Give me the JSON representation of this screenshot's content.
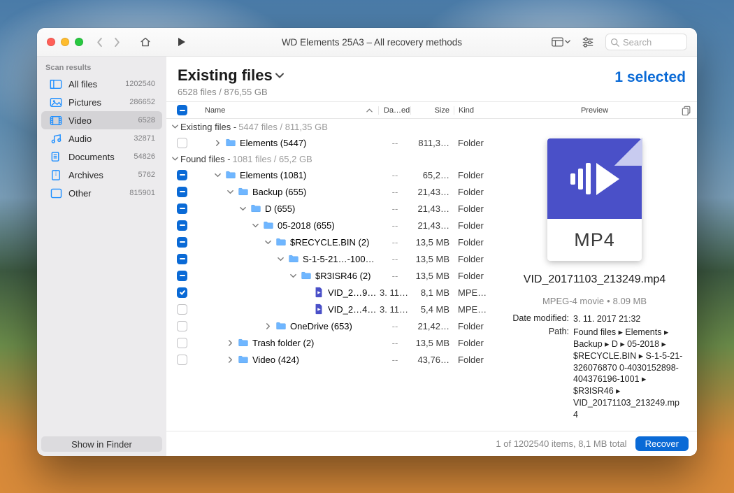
{
  "window_title": "WD Elements 25A3 – All recovery methods",
  "search_placeholder": "Search",
  "sidebar": {
    "heading": "Scan results",
    "items": [
      {
        "label": "All files",
        "count": "1202540",
        "icon": "allfiles"
      },
      {
        "label": "Pictures",
        "count": "286652",
        "icon": "pictures"
      },
      {
        "label": "Video",
        "count": "6528",
        "icon": "video",
        "selected": true
      },
      {
        "label": "Audio",
        "count": "32871",
        "icon": "audio"
      },
      {
        "label": "Documents",
        "count": "54826",
        "icon": "documents"
      },
      {
        "label": "Archives",
        "count": "5762",
        "icon": "archives"
      },
      {
        "label": "Other",
        "count": "815901",
        "icon": "other"
      }
    ],
    "finder_btn": "Show in Finder"
  },
  "header": {
    "title": "Existing files",
    "subtitle": "6528 files / 876,55 GB",
    "selected": "1 selected"
  },
  "columns": {
    "name": "Name",
    "date": "Da…ed",
    "size": "Size",
    "kind": "Kind"
  },
  "sections": {
    "existing": {
      "label": "Existing files",
      "meta": "5447 files / 811,35 GB"
    },
    "found": {
      "label": "Found files",
      "meta": "1081 files / 65,2 GB"
    }
  },
  "rows": [
    {
      "indent": 1,
      "chev": "right",
      "check": "none",
      "icon": "folder",
      "name": "Elements (5447)",
      "date": "--",
      "size": "811,3…",
      "kind": "Folder"
    },
    {
      "section": "found"
    },
    {
      "indent": 1,
      "chev": "down",
      "check": "some",
      "icon": "folder",
      "name": "Elements (1081)",
      "date": "--",
      "size": "65,2…",
      "kind": "Folder"
    },
    {
      "indent": 2,
      "chev": "down",
      "check": "some",
      "icon": "folder",
      "name": "Backup (655)",
      "date": "--",
      "size": "21,43…",
      "kind": "Folder"
    },
    {
      "indent": 3,
      "chev": "down",
      "check": "some",
      "icon": "folder",
      "name": "D (655)",
      "date": "--",
      "size": "21,43…",
      "kind": "Folder"
    },
    {
      "indent": 4,
      "chev": "down",
      "check": "some",
      "icon": "folder",
      "name": "05-2018 (655)",
      "date": "--",
      "size": "21,43…",
      "kind": "Folder"
    },
    {
      "indent": 5,
      "chev": "down",
      "check": "some",
      "icon": "folder",
      "name": "$RECYCLE.BIN (2)",
      "date": "--",
      "size": "13,5 MB",
      "kind": "Folder"
    },
    {
      "indent": 6,
      "chev": "down",
      "check": "some",
      "icon": "folder",
      "name": "S-1-5-21…-1001 (2)",
      "date": "--",
      "size": "13,5 MB",
      "kind": "Folder"
    },
    {
      "indent": 7,
      "chev": "down",
      "check": "some",
      "icon": "folder",
      "name": "$R3ISR46 (2)",
      "date": "--",
      "size": "13,5 MB",
      "kind": "Folder"
    },
    {
      "indent": 8,
      "chev": "",
      "check": "checked",
      "icon": "file",
      "name": "VID_2…9.mp4",
      "date": "3. 11.…",
      "size": "8,1 MB",
      "kind": "MPEG…"
    },
    {
      "indent": 8,
      "chev": "",
      "check": "none",
      "icon": "file",
      "name": "VID_2…4.mp4",
      "date": "3. 11.…",
      "size": "5,4 MB",
      "kind": "MPEG…"
    },
    {
      "indent": 5,
      "chev": "right",
      "check": "none",
      "icon": "folder",
      "name": "OneDrive (653)",
      "date": "--",
      "size": "21,42…",
      "kind": "Folder"
    },
    {
      "indent": 2,
      "chev": "right",
      "check": "none",
      "icon": "folder",
      "name": "Trash folder (2)",
      "date": "--",
      "size": "13,5 MB",
      "kind": "Folder"
    },
    {
      "indent": 2,
      "chev": "right",
      "check": "none",
      "icon": "folder",
      "name": "Video (424)",
      "date": "--",
      "size": "43,76…",
      "kind": "Folder"
    }
  ],
  "preview": {
    "heading": "Preview",
    "ext_label": "MP4",
    "filename": "VID_20171103_213249.mp4",
    "kind": "MPEG-4 movie",
    "size": "8.09 MB",
    "date_label": "Date modified:",
    "date_value": "3. 11. 2017 21:32",
    "path_label": "Path:",
    "path_value": "Found files ▸ Elements ▸ Backup ▸ D ▸ 05-2018 ▸ $RECYCLE.BIN ▸ S-1-5-21-326076870 0-4030152898-404376196-1001 ▸ $R3ISR46 ▸ VID_20171103_213249.mp4"
  },
  "footer": {
    "status": "1 of 1202540 items, 8,1 MB total",
    "recover": "Recover"
  }
}
